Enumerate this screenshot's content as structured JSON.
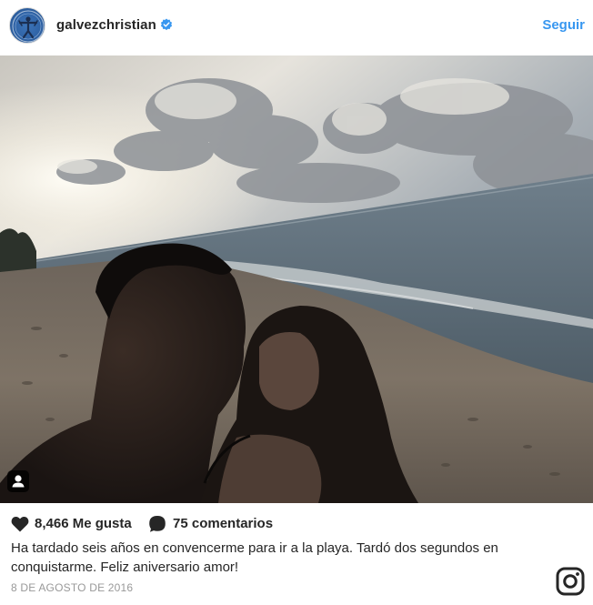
{
  "header": {
    "username": "galvezchristian",
    "verified_icon": "verified-badge-icon",
    "follow_label": "Seguir",
    "accent_color": "#3897f0"
  },
  "photo": {
    "user_tag_icon": "user-tag-icon"
  },
  "stats": {
    "likes_icon": "heart-icon",
    "likes": "8,466 Me gusta",
    "comments_icon": "comment-bubble-icon",
    "comments": "75 comentarios"
  },
  "caption": {
    "text": "Ha tardado seis años en convencerme para ir a la playa. Tardó dos segundos en conquistarme. Feliz aniversario amor!"
  },
  "date": "8 DE AGOSTO DE 2016",
  "footer": {
    "logo_icon": "instagram-icon"
  }
}
